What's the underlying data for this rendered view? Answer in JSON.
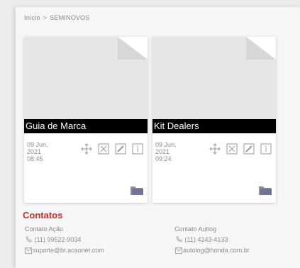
{
  "breadcrumb": {
    "home": "Início",
    "separator": ">",
    "current": "SEMINOVOS"
  },
  "cards": [
    {
      "title": "Guia de Marca",
      "date_line1": "09 Jun,",
      "date_line2": "2021",
      "time": "08:45"
    },
    {
      "title": "Kit Dealers",
      "date_line1": "09 Jun,",
      "date_line2": "2021",
      "time": "09:24"
    }
  ],
  "contacts": {
    "title": "Contatos",
    "left": {
      "heading": "Contato Ação",
      "phone": "(11) 99522-9034",
      "email": "suporte@br.acaonet.com"
    },
    "right": {
      "heading": "Contato Autlog",
      "phone": "(11) 4243-4133",
      "email": "autolog@honda.com.br"
    }
  },
  "icons": {
    "move": "move-arrows-icon",
    "delete": "close-box-icon",
    "edit": "edit-pencil-icon",
    "info": "info-icon",
    "folder": "folder-icon",
    "phone": "phone-icon",
    "email": "mail-icon"
  },
  "colors": {
    "accent": "#d22b2b",
    "title_bar": "#000000",
    "folder": "#7a7f95"
  }
}
